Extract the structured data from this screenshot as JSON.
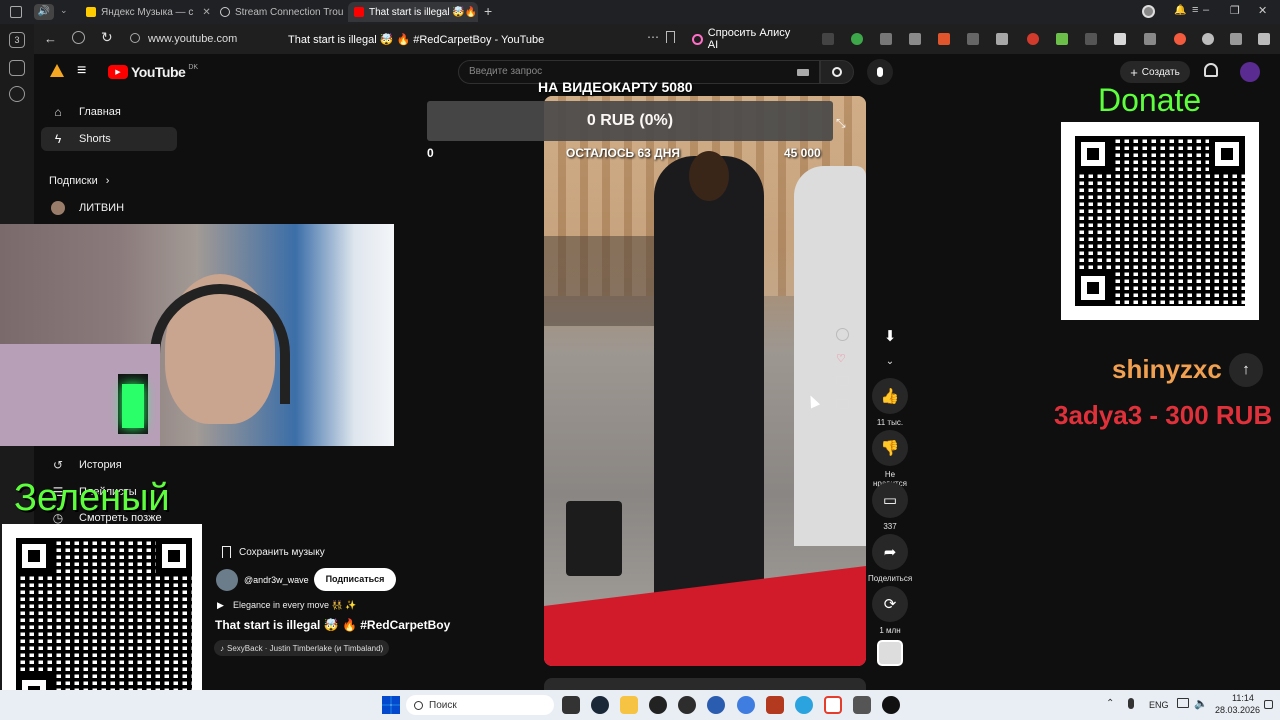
{
  "browser": {
    "tabs": [
      {
        "label": "Яндекс Музыка — с",
        "color": "#ffcc00"
      },
      {
        "label": "Stream Connection Troubl",
        "color": "#cccccc"
      },
      {
        "label": "That start is illegal 🤯🔥",
        "color": "#ff0000"
      }
    ],
    "url": "www.youtube.com",
    "page_title": "That start is illegal 🤯 🔥 #RedCarpetBoy - YouTube",
    "alice_label": "Спросить Алису AI",
    "side_counter": "3"
  },
  "youtube": {
    "logo": "YouTube",
    "region": "DK",
    "search_placeholder": "Введите запрос",
    "create_label": "Создать",
    "sidebar": {
      "home": "Главная",
      "shorts": "Shorts",
      "subscriptions": "Подписки",
      "channel": "ЛИТВИН",
      "history": "История",
      "playlists": "Плейлисты",
      "watch_later": "Смотреть позже"
    },
    "short": {
      "save_music": "Сохранить музыку",
      "channel": "@andr3w_wave",
      "subscribe": "Подписаться",
      "description": "Elegance in every move 👯 ✨",
      "title": "That start is illegal 🤯 🔥 #RedCarpetBoy",
      "music": "SexyBack · Justin Timberlake (и Timbaland)"
    },
    "actions": {
      "likes": "11 тыс.",
      "dislike": "Не нравится",
      "comments": "337",
      "share": "Поделиться",
      "remix": "1 млн"
    }
  },
  "overlay": {
    "goal_title": "НА ВИДЕОКАРТУ 5080",
    "goal_amount": "0 RUB (0%)",
    "goal_min": "0",
    "goal_days": "ОСТАЛОСЬ 63 ДНЯ",
    "goal_max": "45 000",
    "donate": "Donate",
    "donor_name": "shinyzxc",
    "donor_msg": "3adya3 - 300 RUB",
    "green_text": "Зеленый"
  },
  "taskbar": {
    "search": "Поиск",
    "lang": "ENG",
    "time": "11:14",
    "date": "28.03.2026"
  }
}
